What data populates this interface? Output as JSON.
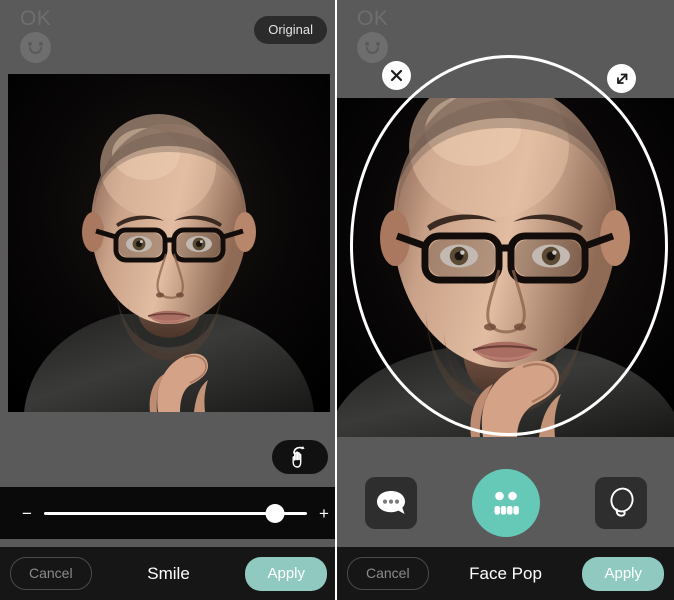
{
  "app": {
    "brand_text": "OK",
    "brand_icon": "smiley-face-logo"
  },
  "left_panel": {
    "name": "Smile editor screen",
    "original_button": "Original",
    "hand_tool_icon": "rotate-hand-icon",
    "slider": {
      "minus_label": "−",
      "plus_label": "+",
      "value_percent": 88
    },
    "bottom": {
      "cancel_label": "Cancel",
      "title": "Smile",
      "apply_label": "Apply"
    }
  },
  "right_panel": {
    "name": "Face Pop editor screen",
    "selection": {
      "close_icon": "close-x-icon",
      "resize_icon": "resize-diagonal-icon",
      "shape": "ellipse"
    },
    "tools": [
      {
        "icon": "speech-bubble-dots-icon",
        "name": "speech-bubble-tool",
        "selected": false
      },
      {
        "icon": "face-pop-emoji-icon",
        "name": "face-pop-tool",
        "selected": true
      },
      {
        "icon": "lasso-icon",
        "name": "lasso-tool",
        "selected": false
      }
    ],
    "bottom": {
      "cancel_label": "Cancel",
      "title": "Face Pop",
      "apply_label": "Apply"
    }
  },
  "colors": {
    "accent_teal": "#66c9b7",
    "apply_teal": "#8fc9bf",
    "panel_bg": "#5a5a5a",
    "bar_bg": "#161616",
    "pill_bg": "#2b2b2b"
  }
}
